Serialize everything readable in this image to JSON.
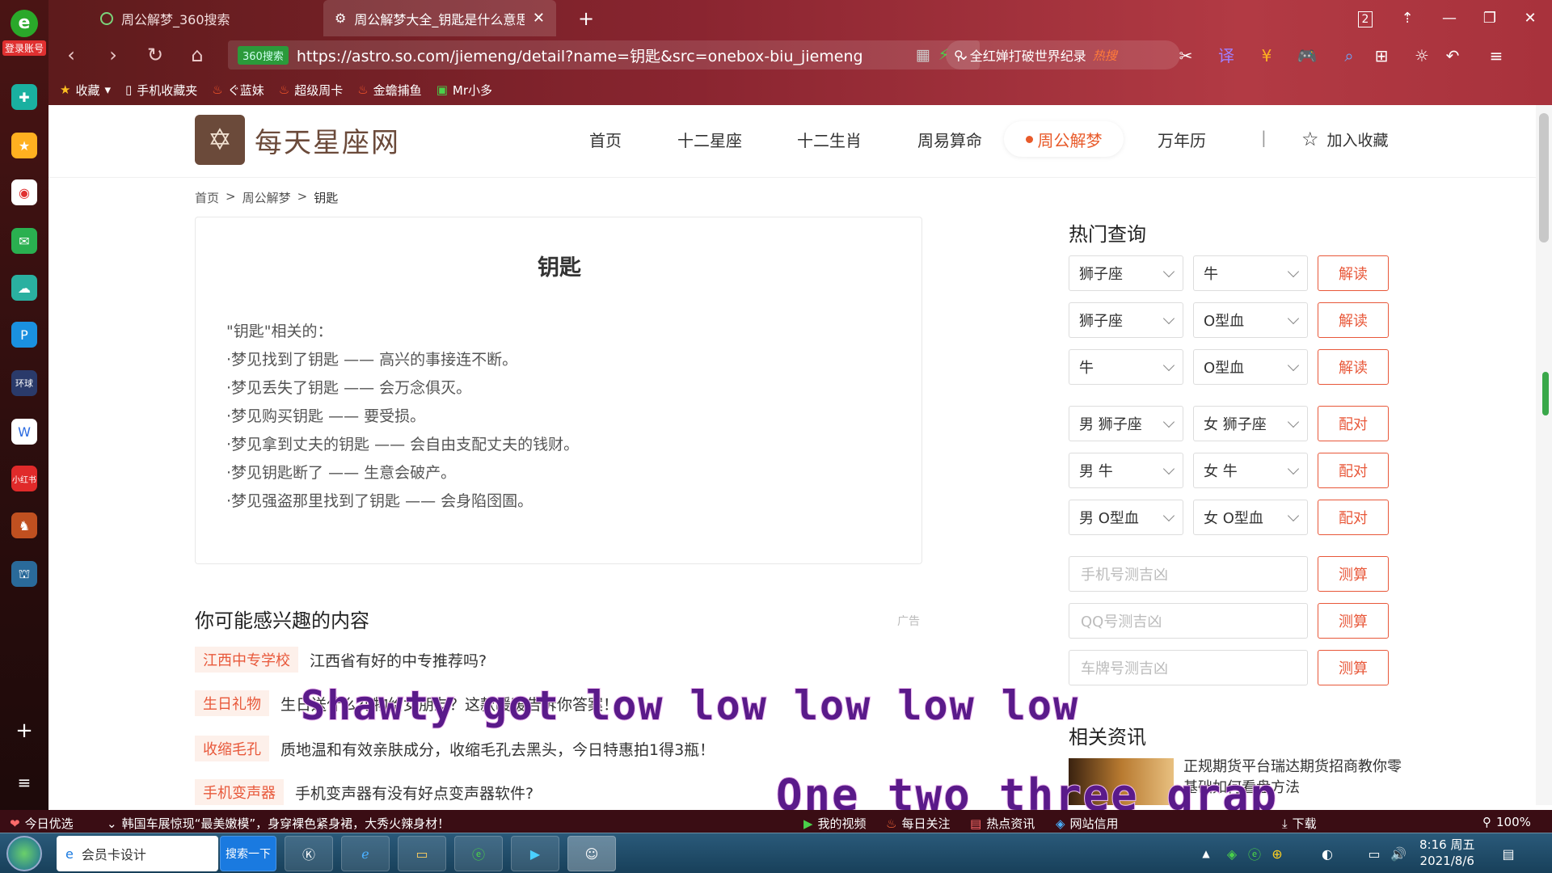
{
  "browser": {
    "tabs": [
      {
        "label": "周公解梦_360搜索",
        "active": false
      },
      {
        "label": "周公解梦大全_钥匙是什么意思,",
        "active": true
      }
    ],
    "window_controls": [
      "2",
      "⇡",
      "—",
      "❐",
      "✕"
    ],
    "address": {
      "safe_badge": "360搜索",
      "url": "https://astro.so.com/jiemeng/detail?name=钥匙&src=onebox-biu_jiemeng"
    },
    "search": {
      "text": "全红婵打破世界纪录",
      "hot": "热搜"
    },
    "bookmarks": [
      "收藏",
      "手机收藏夹",
      "ぐ蓝妹",
      "超级周卡",
      "金蟾捕鱼",
      "Mr小多"
    ],
    "login_badge": "登录账号"
  },
  "site": {
    "logo_text": "每天星座网",
    "nav": [
      "首页",
      "十二星座",
      "十二生肖",
      "周易算命",
      "周公解梦",
      "万年历"
    ],
    "nav_active": "周公解梦",
    "nav_separator": "|",
    "favorite": "加入收藏",
    "breadcrumb": [
      "首页",
      ">",
      "周公解梦",
      ">",
      "钥匙"
    ]
  },
  "article": {
    "title": "钥匙",
    "lines": [
      "\"钥匙\"相关的：",
      "·梦见找到了钥匙 —— 高兴的事接连不断。",
      "·梦见丢失了钥匙 —— 会万念俱灭。",
      "·梦见购买钥匙 —— 要受损。",
      "·梦见拿到丈夫的钥匙 —— 会自由支配丈夫的钱财。",
      "·梦见钥匙断了 —— 生意会破产。",
      "·梦见强盗那里找到了钥匙 —— 会身陷囹圄。"
    ]
  },
  "interest": {
    "title": "你可能感兴趣的内容",
    "ad": "广告",
    "items": [
      {
        "tag": "江西中专学校",
        "text": "江西省有好的中专推荐吗?"
      },
      {
        "tag": "生日礼物",
        "text": "生日送什么礼物给女朋友？这款暖暖告诉你答案！"
      },
      {
        "tag": "收缩毛孔",
        "text": "质地温和有效亲肤成分，收缩毛孔去黑头，今日特惠拍1得3瓶！"
      },
      {
        "tag": "手机变声器",
        "text": "手机变声器有没有好点变声器软件?"
      }
    ]
  },
  "sidebar": {
    "hot_title": "热门查询",
    "queries": [
      {
        "a": "狮子座",
        "b": "牛",
        "btn": "解读"
      },
      {
        "a": "狮子座",
        "b": "O型血",
        "btn": "解读"
      },
      {
        "a": "牛",
        "b": "O型血",
        "btn": "解读"
      },
      {
        "a": "男 狮子座",
        "b": "女 狮子座",
        "btn": "配对"
      },
      {
        "a": "男 牛",
        "b": "女 牛",
        "btn": "配对"
      },
      {
        "a": "男 O型血",
        "b": "女 O型血",
        "btn": "配对"
      }
    ],
    "inputs": [
      {
        "placeholder": "手机号测吉凶",
        "btn": "测算"
      },
      {
        "placeholder": "QQ号测吉凶",
        "btn": "测算"
      },
      {
        "placeholder": "车牌号测吉凶",
        "btn": "测算"
      }
    ],
    "news_title": "相关资讯",
    "news_text": "正规期货平台瑞达期货招商教你零基础如何看盘方法"
  },
  "status_bar": {
    "left": "今日优选",
    "headline": "韩国车展惊现“最美嫩模”，身穿裸色紧身裙，大秀火辣身材！",
    "items": [
      "我的视频",
      "每日关注",
      "热点资讯",
      "网站信用",
      "下载"
    ],
    "zoom": "100%"
  },
  "taskbar": {
    "app_label": "会员卡设计",
    "search_btn": "搜索一下",
    "time": "8:16 周五",
    "date": "2021/8/6"
  },
  "overlay": {
    "lyric1": "Shawty got low low low low low",
    "lyric2": "One two three grap"
  }
}
